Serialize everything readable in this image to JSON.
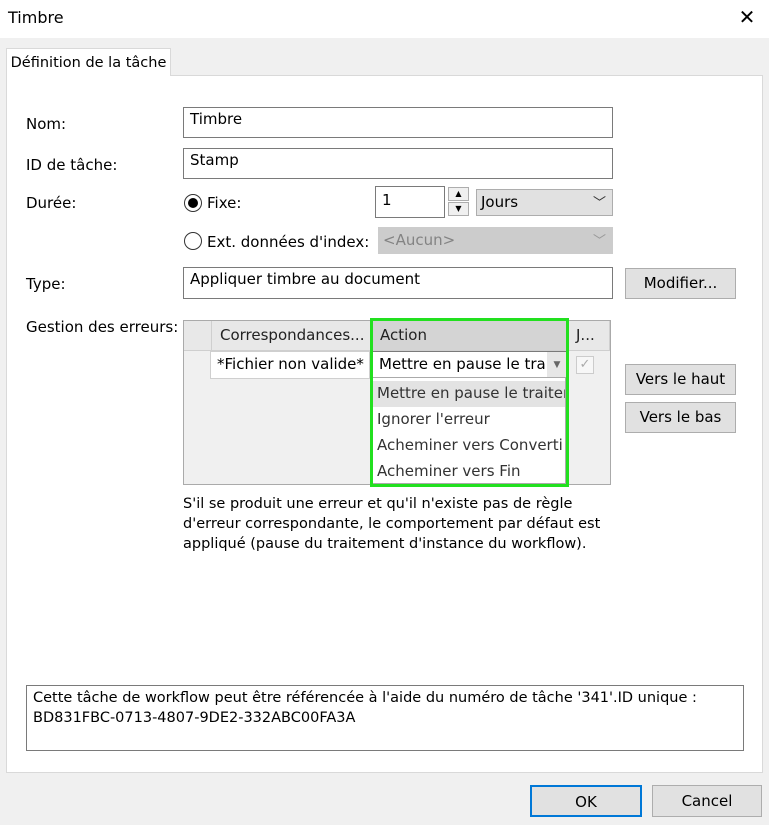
{
  "window": {
    "title": "Timbre",
    "close_glyph": "✕"
  },
  "tabs": [
    {
      "label": "Définition de la tâche"
    }
  ],
  "form": {
    "nom_label": "Nom:",
    "nom_value": "Timbre",
    "id_label": "ID de tâche:",
    "id_value": "Stamp",
    "duree_label": "Durée:",
    "fixe_label": "Fixe:",
    "duree_value": "1",
    "unit_value": "Jours",
    "ext_label": "Ext. données d'index:",
    "ext_value": "<Aucun>",
    "type_label": "Type:",
    "type_value": "Appliquer timbre au document",
    "modifier_label": "Modifier...",
    "erreurs_label": "Gestion des erreurs:"
  },
  "error_grid": {
    "columns": [
      "Correspondances...",
      "Action",
      "J..."
    ],
    "rows": [
      {
        "match": "*Fichier non valide*",
        "action": "Mettre en pause le tra",
        "checked": true
      }
    ],
    "dropdown_options": [
      "Mettre en pause le traiten",
      "Ignorer l'erreur",
      "Acheminer vers Converti",
      "Acheminer vers Fin"
    ],
    "selected_index": 0
  },
  "side_buttons": {
    "up": "Vers le haut",
    "down": "Vers le bas"
  },
  "info_lines": [
    "S'il se produit une erreur et qu'il n'existe pas de règle",
    "d'erreur correspondante, le comportement par défaut est",
    "appliqué (pause du traitement d'instance du workflow)."
  ],
  "footer_lines": [
    "Cette tâche de workflow peut être référencée à l'aide du numéro de tâche '341'.ID unique :",
    "BD831FBC-0713-4807-9DE2-332ABC00FA3A"
  ],
  "buttons": {
    "ok": "OK",
    "cancel": "Cancel"
  },
  "colors": {
    "highlight": "#22e01f",
    "ok_border": "#0078d7"
  }
}
